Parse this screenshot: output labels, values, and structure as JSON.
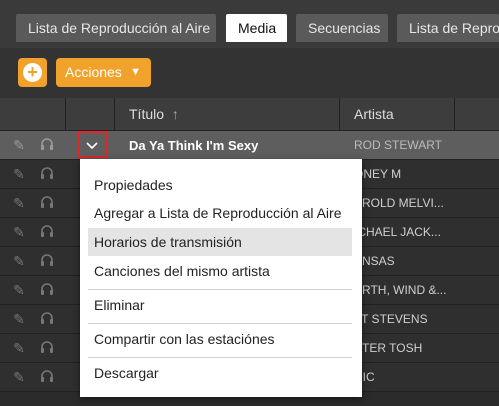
{
  "tabs": [
    {
      "label": "Lista de Reproducción al Aire"
    },
    {
      "label": "Media"
    },
    {
      "label": "Secuencias"
    },
    {
      "label": "Lista de Reproc"
    }
  ],
  "toolbar": {
    "plus_label": "+",
    "acciones_label": "Acciones"
  },
  "table": {
    "headers": {
      "titulo": "Título",
      "artista": "Artista"
    },
    "rows": [
      {
        "title": "Da Ya Think I'm Sexy",
        "artist": "ROD STEWART"
      },
      {
        "title": "",
        "artist": "ONEY M"
      },
      {
        "title": "",
        "artist": "AROLD MELVI..."
      },
      {
        "title": "",
        "artist": "ICHAEL JACK..."
      },
      {
        "title": "",
        "artist": "ANSAS"
      },
      {
        "title": "",
        "artist": "ARTH, WIND &..."
      },
      {
        "title": "",
        "artist": "AT STEVENS"
      },
      {
        "title": "",
        "artist": "ETER TOSH"
      },
      {
        "title": "",
        "artist": "HIC"
      }
    ]
  },
  "menu": {
    "items": [
      "Propiedades",
      "Agregar a Lista de Reproducción al Aire",
      "Horarios de transmisión",
      "Canciones del mismo artista",
      "Eliminar",
      "Compartir con las estaciónes",
      "Descargar"
    ],
    "highlighted_index": 2
  },
  "colors": {
    "accent": "#f0a22b",
    "highlight_border": "#e0262b"
  }
}
